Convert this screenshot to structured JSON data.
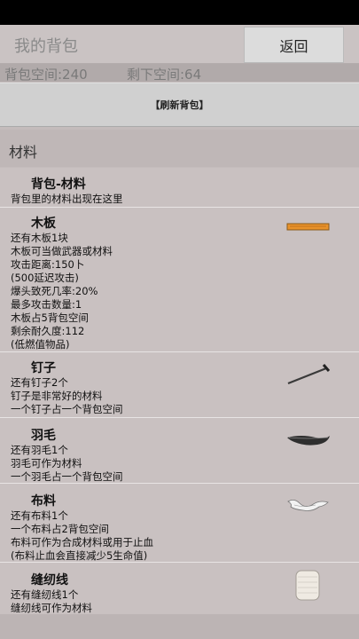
{
  "header": {
    "title": "我的背包",
    "back_label": "返回"
  },
  "space": {
    "total": "背包空间:240",
    "remaining": "剩下空间:64"
  },
  "refresh_label": "【刷新背包】",
  "section_title": "材料",
  "items": [
    {
      "name": "背包-材料",
      "lines": [
        "背包里的材料出现在这里"
      ],
      "icon": ""
    },
    {
      "name": "木板",
      "lines": [
        "还有木板1块",
        "木板可当做武器或材料",
        "攻击距离:150卜",
        "(500延迟攻击)",
        "爆头致死几率:20%",
        "最多攻击数量:1",
        "木板占5背包空间",
        "剩余耐久度:112",
        "(低燃值物品)"
      ],
      "icon": "wood-plank-icon"
    },
    {
      "name": "钉子",
      "lines": [
        "还有钉子2个",
        "钉子是非常好的材料",
        "一个钉子占一个背包空间"
      ],
      "icon": "nail-icon"
    },
    {
      "name": "羽毛",
      "lines": [
        "还有羽毛1个",
        "羽毛可作为材料",
        "一个羽毛占一个背包空间"
      ],
      "icon": "feather-icon"
    },
    {
      "name": "布料",
      "lines": [
        "还有布料1个",
        "一个布料占2背包空间",
        "布料可作为合成材料或用于止血",
        "(布料止血会直接减少5生命值)"
      ],
      "icon": "cloth-icon"
    },
    {
      "name": "缝纫线",
      "lines": [
        "还有缝纫线1个",
        "缝纫线可作为材料"
      ],
      "icon": "thread-spool-icon"
    }
  ]
}
